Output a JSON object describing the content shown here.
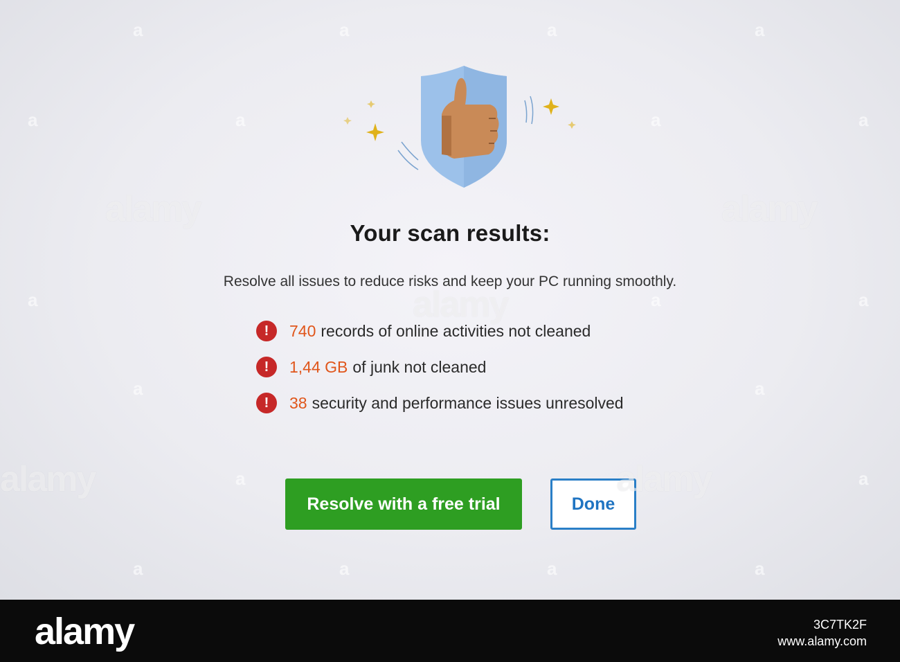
{
  "dialog": {
    "title": "Your scan results:",
    "subtitle": "Resolve all issues to reduce risks and keep your PC running smoothly.",
    "issue_icon_glyph": "!",
    "issues": [
      {
        "count": "740",
        "text": "records of online activities not cleaned"
      },
      {
        "count": "1,44 GB",
        "text": "of junk not cleaned"
      },
      {
        "count": "38",
        "text": "security and performance issues unresolved"
      }
    ],
    "primary_button": "Resolve with a free trial",
    "secondary_button": "Done"
  },
  "watermark": {
    "brand": "alamy",
    "small_mark": "a",
    "image_id": "3C7TK2F",
    "site": "www.alamy.com"
  },
  "colors": {
    "accent_green": "#2e9e22",
    "accent_blue": "#2a7fc7",
    "issue_count": "#e0561b",
    "issue_icon": "#c62828",
    "shield": "#9cc1ea",
    "hand": "#c98a57"
  },
  "icons": [
    "thumbs-up-shield-icon",
    "sparkle-icon",
    "error-icon"
  ]
}
